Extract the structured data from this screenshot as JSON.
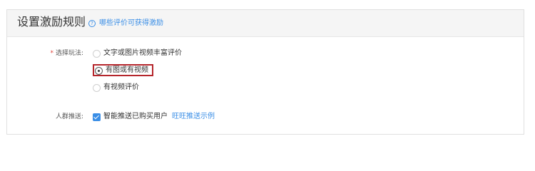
{
  "header": {
    "title": "设置激励规则",
    "help_icon": "question-circle-icon",
    "help_text": "哪些评价可获得激励"
  },
  "play_mode": {
    "required_mark": "*",
    "label": "选择玩法:",
    "options": [
      {
        "label": "文字或图片视频丰富评价",
        "selected": false
      },
      {
        "label": "有图或有视频",
        "selected": true
      },
      {
        "label": "有视频评价",
        "selected": false
      }
    ]
  },
  "audience": {
    "label": "人群推送:",
    "checkbox_label": "智能推送已购买用户",
    "checked": true,
    "example_link": "旺旺推送示例"
  },
  "colors": {
    "accent": "#3a8ee6",
    "highlight_border": "#b5262c",
    "required": "#e0443b"
  }
}
